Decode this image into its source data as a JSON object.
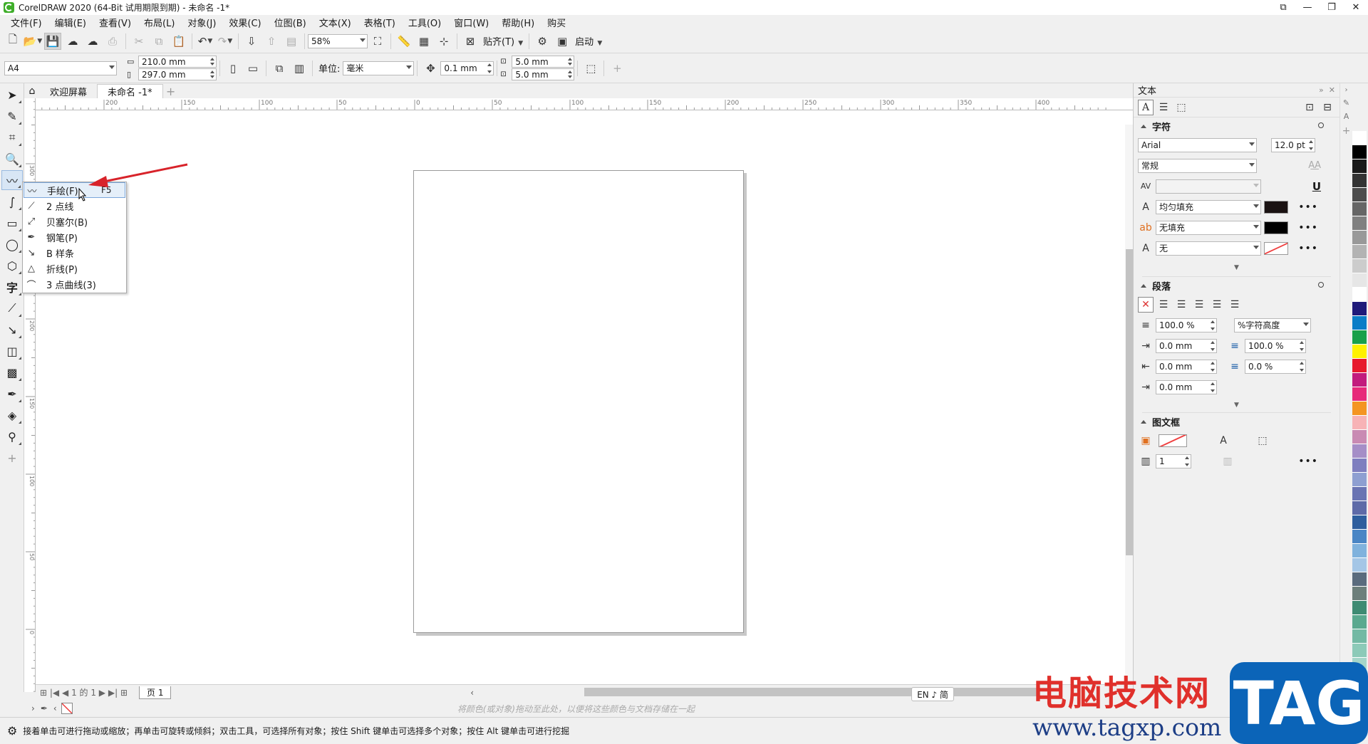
{
  "app": {
    "title": "CorelDRAW 2020 (64-Bit 试用期限到期) - 未命名 -1*"
  },
  "menu": [
    "文件(F)",
    "编辑(E)",
    "查看(V)",
    "布局(L)",
    "对象(J)",
    "效果(C)",
    "位图(B)",
    "文本(X)",
    "表格(T)",
    "工具(O)",
    "窗口(W)",
    "帮助(H)",
    "购买"
  ],
  "toolbar": {
    "zoom": "58%",
    "snap_label": "贴齐(T)",
    "launch_label": "启动"
  },
  "propbar": {
    "page_size": "A4",
    "width": "210.0 mm",
    "height": "297.0 mm",
    "unit_label": "单位:",
    "unit": "毫米",
    "nudge": "0.1 mm",
    "dup_x": "5.0 mm",
    "dup_y": "5.0 mm"
  },
  "tabs": {
    "welcome": "欢迎屏幕",
    "doc": "未命名 -1*"
  },
  "ruler": {
    "h_ticks": [
      "200",
      "150",
      "100",
      "50",
      "0",
      "50",
      "100",
      "150",
      "200",
      "250",
      "300",
      "350",
      "400"
    ],
    "v_ticks": [
      "300",
      "250",
      "200",
      "150",
      "100",
      "50",
      "0"
    ]
  },
  "flyout": [
    {
      "label": "手绘(F)",
      "key": "F5",
      "icon": "freehand-icon"
    },
    {
      "label": "2 点线",
      "key": "",
      "icon": "two-point-line-icon"
    },
    {
      "label": "贝塞尔(B)",
      "key": "",
      "icon": "bezier-icon"
    },
    {
      "label": "钢笔(P)",
      "key": "",
      "icon": "pen-icon"
    },
    {
      "label": "B 样条",
      "key": "",
      "icon": "b-spline-icon"
    },
    {
      "label": "折线(P)",
      "key": "",
      "icon": "polyline-icon"
    },
    {
      "label": "3 点曲线(3)",
      "key": "",
      "icon": "three-point-curve-icon"
    }
  ],
  "docker": {
    "title": "文本",
    "char_section": "字符",
    "font": "Arial",
    "font_size": "12.0 pt",
    "font_style": "常规",
    "fill": "均匀填充",
    "bg_fill": "无填充",
    "outline": "无",
    "para_section": "段落",
    "line_spacing": "100.0 %",
    "line_spacing_unit": "%字符高度",
    "indent_first": "0.0 mm",
    "indent_left": "0.0 mm",
    "indent_right": "0.0 mm",
    "before_para": "100.0 %",
    "after_para": "0.0 %",
    "frame_section": "图文框",
    "columns": "1"
  },
  "bottom": {
    "page_tab": "页 1",
    "page_info": "1 的 1"
  },
  "colorwell": {
    "hint": "将颜色(或对象)拖动至此处，以便将这些颜色与文档存储在一起"
  },
  "ime": {
    "label": "EN ♪ 简"
  },
  "status": {
    "text": "接着单击可进行拖动或缩放；再单击可旋转或倾斜；双击工具，可选择所有对象；按住 Shift 键单击可选择多个对象；按住 Alt 键单击可进行挖掘"
  },
  "watermark": {
    "cn": "电脑技术网",
    "url": "www.tagxp.com",
    "tag": "TAG"
  },
  "palette": [
    "#ffffff",
    "#000000",
    "#1a1a1a",
    "#333333",
    "#4d4d4d",
    "#666666",
    "#808080",
    "#999999",
    "#b3b3b3",
    "#cccccc",
    "#e6e6e6",
    "#ffffff",
    "#1f1a7a",
    "#0b7dc7",
    "#1aa04a",
    "#fff100",
    "#e7192d",
    "#c21a7d",
    "#e7297a",
    "#f49522",
    "#f7b3b6",
    "#c98ab3",
    "#a58ec7",
    "#7f7fbf",
    "#8e9fd1",
    "#6a74b3",
    "#5e6aa8",
    "#2e5e9e",
    "#4a86c5",
    "#7fb2dd",
    "#a4c6e6",
    "#5a6b7d",
    "#6d7f7b",
    "#3e8b73",
    "#5aa98f",
    "#73b9a4",
    "#8ccab8",
    "#a5d5c9"
  ]
}
